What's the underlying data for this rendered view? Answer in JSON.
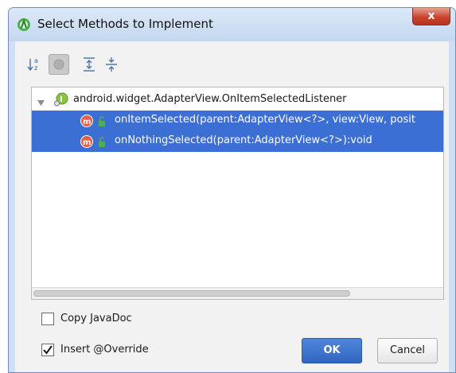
{
  "window": {
    "title": "Select Methods to Implement",
    "close_glyph": "x"
  },
  "toolbar": {
    "items": [
      {
        "icon": "sort-alphabetically-icon",
        "pressed": false
      },
      {
        "icon": "show-classes-icon",
        "pressed": true
      },
      {
        "icon": "expand-all-icon",
        "pressed": false
      },
      {
        "icon": "collapse-all-icon",
        "pressed": false
      }
    ]
  },
  "tree": {
    "interface_label": "android.widget.AdapterView.OnItemSelectedListener",
    "methods": [
      {
        "label": "onItemSelected(parent:AdapterView<?>, view:View, posit",
        "selected": true
      },
      {
        "label": "onNothingSelected(parent:AdapterView<?>):void",
        "selected": true
      }
    ]
  },
  "options": {
    "copy_javadoc": {
      "label": "Copy JavaDoc",
      "checked": false
    },
    "insert_override": {
      "label": "Insert @Override",
      "checked": true
    }
  },
  "buttons": {
    "ok": "OK",
    "cancel": "Cancel"
  },
  "colors": {
    "selection": "#3c6fd4",
    "ok_button": "#3a6fcc",
    "close_button": "#c9452f"
  }
}
